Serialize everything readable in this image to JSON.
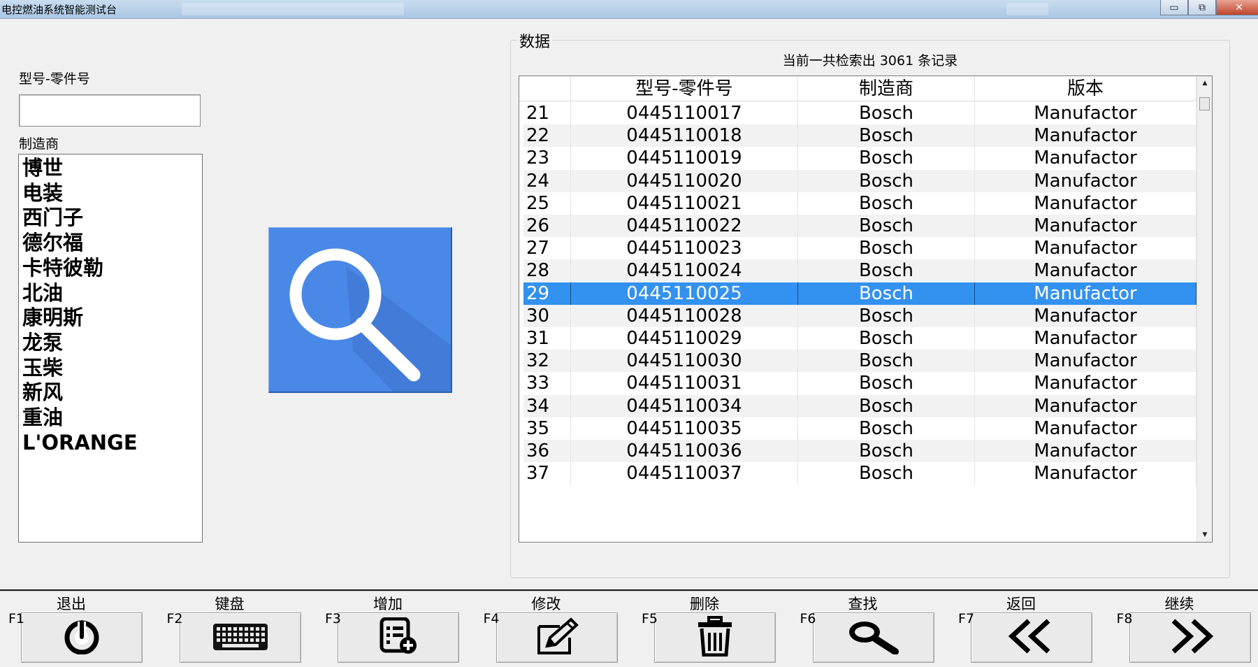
{
  "window": {
    "title": "电控燃油系统智能测试台",
    "controls": {
      "minimize": "▭",
      "restore": "⧉",
      "close": "✕"
    }
  },
  "left_panel": {
    "part_label": "型号-零件号",
    "part_value": "",
    "manufacturer_label": "制造商",
    "manufacturers": [
      "博世",
      "电装",
      "西门子",
      "德尔福",
      "卡特彼勒",
      "北油",
      "康明斯",
      "龙泵",
      "玉柴",
      "新风",
      "重油",
      "L'ORANGE"
    ]
  },
  "search": {
    "icon": "magnifier-icon",
    "color": "#4a88e8"
  },
  "data_panel": {
    "legend": "数据",
    "record_count": "当前一共检索出 3061 条记录",
    "columns": [
      "",
      "型号-零件号",
      "制造商",
      "版本"
    ],
    "selected_row": 29,
    "rows": [
      [
        "21",
        "0445110017",
        "Bosch",
        "Manufactor"
      ],
      [
        "22",
        "0445110018",
        "Bosch",
        "Manufactor"
      ],
      [
        "23",
        "0445110019",
        "Bosch",
        "Manufactor"
      ],
      [
        "24",
        "0445110020",
        "Bosch",
        "Manufactor"
      ],
      [
        "25",
        "0445110021",
        "Bosch",
        "Manufactor"
      ],
      [
        "26",
        "0445110022",
        "Bosch",
        "Manufactor"
      ],
      [
        "27",
        "0445110023",
        "Bosch",
        "Manufactor"
      ],
      [
        "28",
        "0445110024",
        "Bosch",
        "Manufactor"
      ],
      [
        "29",
        "0445110025",
        "Bosch",
        "Manufactor"
      ],
      [
        "30",
        "0445110028",
        "Bosch",
        "Manufactor"
      ],
      [
        "31",
        "0445110029",
        "Bosch",
        "Manufactor"
      ],
      [
        "32",
        "0445110030",
        "Bosch",
        "Manufactor"
      ],
      [
        "33",
        "0445110031",
        "Bosch",
        "Manufactor"
      ],
      [
        "34",
        "0445110034",
        "Bosch",
        "Manufactor"
      ],
      [
        "35",
        "0445110035",
        "Bosch",
        "Manufactor"
      ],
      [
        "36",
        "0445110036",
        "Bosch",
        "Manufactor"
      ],
      [
        "37",
        "0445110037",
        "Bosch",
        "Manufactor"
      ]
    ],
    "selection_color": "#3391f0"
  },
  "function_keys": [
    {
      "key": "F1",
      "label": "退出",
      "icon": "power-icon"
    },
    {
      "key": "F2",
      "label": "键盘",
      "icon": "keyboard-icon"
    },
    {
      "key": "F3",
      "label": "增加",
      "icon": "add-list-icon"
    },
    {
      "key": "F4",
      "label": "修改",
      "icon": "edit-icon"
    },
    {
      "key": "F5",
      "label": "删除",
      "icon": "trash-icon"
    },
    {
      "key": "F6",
      "label": "查找",
      "icon": "search-icon"
    },
    {
      "key": "F7",
      "label": "返回",
      "icon": "double-left-icon"
    },
    {
      "key": "F8",
      "label": "继续",
      "icon": "double-right-icon"
    }
  ]
}
